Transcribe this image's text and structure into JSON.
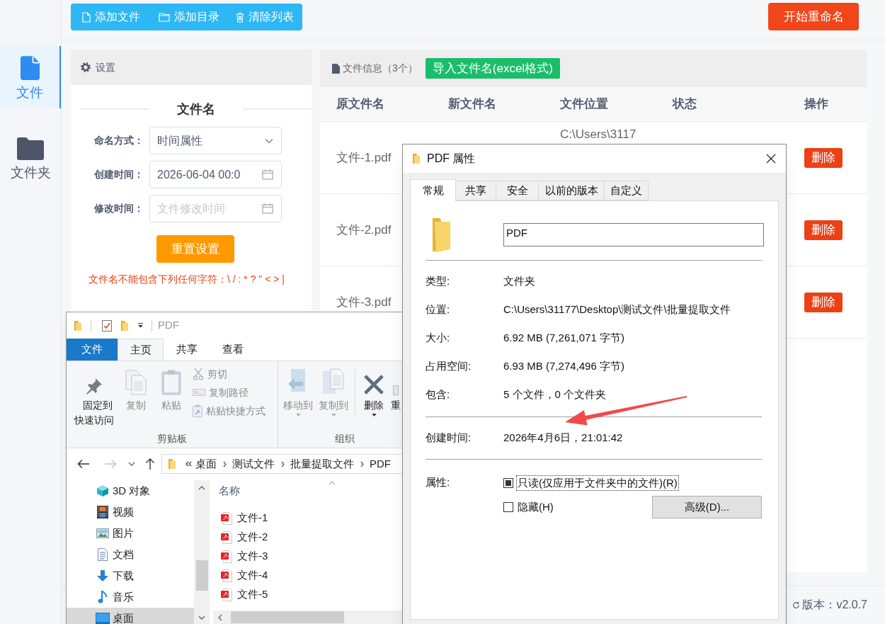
{
  "sidebar": {
    "items": [
      {
        "label": "文件",
        "selected": true
      },
      {
        "label": "文件夹",
        "selected": false
      }
    ]
  },
  "toolbar": {
    "buttons": [
      "添加文件",
      "添加目录",
      "清除列表"
    ],
    "start_button": "开始重命名"
  },
  "settings": {
    "title": "设置",
    "section_title": "文件名",
    "fields": [
      {
        "label": "命名方式：",
        "kind": "select",
        "value": "时间属性"
      },
      {
        "label": "创建时间：",
        "kind": "date",
        "value": "2026-06-04 00:0"
      },
      {
        "label": "修改时间：",
        "kind": "date",
        "placeholder": "文件修改时间"
      }
    ],
    "reset_button": "重置设置",
    "warning": "文件名不能包含下列任何字符：\\ / : * ? \" < > |"
  },
  "file_list": {
    "title": "文件信息（3个）",
    "import_button": "导入文件名(excel格式)",
    "columns": [
      "原文件名",
      "新文件名",
      "文件位置",
      "状态",
      "操作"
    ],
    "rows": [
      {
        "original_name": "文件-1.pdf",
        "location": "C:\\Users\\3117",
        "delete_button": "删除"
      },
      {
        "original_name": "文件-2.pdf",
        "delete_button": "删除"
      },
      {
        "original_name": "文件-3.pdf",
        "delete_button": "删除"
      }
    ]
  },
  "footer": {
    "version": "版本：v2.0.7"
  },
  "explorer": {
    "title": "PDF",
    "tabs": [
      {
        "label": "文件",
        "kind": "menu",
        "selected": false
      },
      {
        "label": "主页",
        "kind": "tab",
        "selected": true
      },
      {
        "label": "共享",
        "kind": "tab",
        "selected": false
      },
      {
        "label": "查看",
        "kind": "tab",
        "selected": false
      }
    ],
    "ribbon": {
      "groups": [
        {
          "label": "剪贴板",
          "sections": [
            {
              "kind": "large",
              "separated": false,
              "items": [
                {
                  "label": "固定到快速访问",
                  "disabled": false,
                  "dropdown": false
                },
                {
                  "label": "复制",
                  "disabled": true,
                  "dropdown": false
                },
                {
                  "label": "粘贴",
                  "disabled": true,
                  "dropdown": false
                }
              ]
            },
            {
              "kind": "small",
              "separated": false,
              "items": [
                {
                  "label": "剪切",
                  "disabled": true
                },
                {
                  "label": "复制路径",
                  "disabled": true
                },
                {
                  "label": "粘贴快捷方式",
                  "disabled": true
                }
              ]
            }
          ]
        },
        {
          "label": "组织",
          "sections": [
            {
              "kind": "large",
              "separated": false,
              "items": [
                {
                  "label": "移动到",
                  "disabled": true,
                  "dropdown": true
                },
                {
                  "label": "复制到",
                  "disabled": true,
                  "dropdown": true
                }
              ]
            },
            {
              "kind": "large",
              "separated": true,
              "items": [
                {
                  "label": "删除",
                  "disabled": false,
                  "dropdown": true
                },
                {
                  "label": "重",
                  "disabled": false,
                  "dropdown": false
                }
              ]
            }
          ]
        }
      ]
    },
    "nav_buttons": [
      {
        "disabled": false
      },
      {
        "disabled": true
      },
      {
        "disabled": false
      },
      {
        "disabled": false
      }
    ],
    "breadcrumbs": [
      "桌面",
      "测试文件",
      "批量提取文件",
      "PDF"
    ],
    "nav_pane": [
      {
        "label": "3D 对象",
        "selected": false
      },
      {
        "label": "视频",
        "selected": false
      },
      {
        "label": "图片",
        "selected": false
      },
      {
        "label": "文档",
        "selected": false
      },
      {
        "label": "下载",
        "selected": false
      },
      {
        "label": "音乐",
        "selected": false
      },
      {
        "label": "桌面",
        "selected": true
      }
    ],
    "column": "名称",
    "files": [
      "文件-1",
      "文件-2",
      "文件-3",
      "文件-4",
      "文件-5"
    ]
  },
  "properties": {
    "title": "PDF 属性",
    "tabs": [
      {
        "label": "常规",
        "selected": true
      },
      {
        "label": "共享",
        "selected": false
      },
      {
        "label": "安全",
        "selected": false
      },
      {
        "label": "以前的版本",
        "selected": false
      },
      {
        "label": "自定义",
        "selected": false
      }
    ],
    "name": "PDF",
    "groups": [
      {
        "rows": [
          {
            "label": "类型:",
            "value": "文件夹"
          },
          {
            "label": "位置:",
            "value": "C:\\Users\\31177\\Desktop\\测试文件\\批量提取文件"
          },
          {
            "label": "大小:",
            "value": "6.92 MB (7,261,071 字节)"
          },
          {
            "label": "占用空间:",
            "value": "6.93 MB (7,274,496 字节)"
          },
          {
            "label": "包含:",
            "value": "5 个文件，0 个文件夹"
          }
        ]
      },
      {
        "rows": [
          {
            "label": "创建时间:",
            "value": "2026年4月6日，21:01:42"
          }
        ]
      }
    ],
    "attributes_label": "属性:",
    "checkboxes": [
      {
        "label": "只读(仅应用于文件夹中的文件)(R)",
        "checked": false,
        "indeterminate": true,
        "focused": true
      },
      {
        "label": "隐藏(H)",
        "checked": false,
        "indeterminate": false,
        "focused": false
      }
    ],
    "advanced_button": "高级(D)..."
  }
}
